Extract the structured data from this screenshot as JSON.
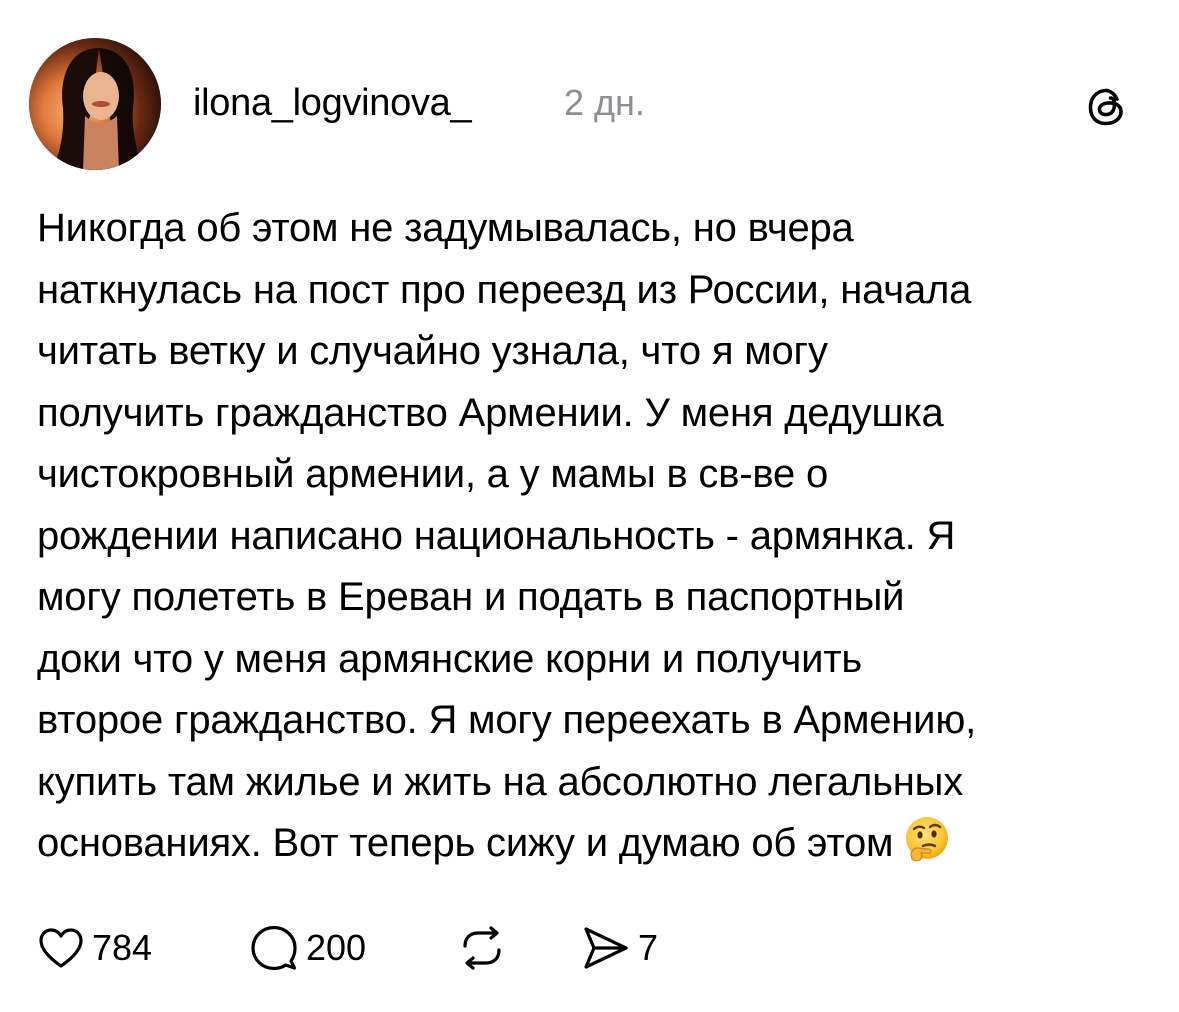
{
  "post": {
    "username": "ilona_logvinova_",
    "time": "2 дн.",
    "text_lines": [
      "Никогда об этом не задумывалась, но вчера",
      "наткнулась на пост про переезд из России, начала",
      "читать ветку и случайно узнала, что я могу",
      "получить гражданство Армении. У меня дедушка",
      "чистокровный армении, а у мамы в св-ве о",
      "рождении написано национальность - армянка. Я",
      "могу полететь в Ереван и подать в паспортный",
      "доки что у меня армянские корни и получить",
      "второе гражданство. Я могу переехать в Армению,",
      "купить там жилье и жить на абсолютно легальных",
      "основаниях. Вот теперь сижу и думаю об этом"
    ]
  },
  "actions": {
    "likes": "784",
    "replies": "200",
    "shares": "7"
  },
  "icons": {
    "like": "heart-icon",
    "reply": "speech-bubble-icon",
    "repost": "repost-icon",
    "share": "send-icon",
    "app": "threads-logo-icon",
    "emoji": "thinking-face-emoji"
  },
  "colors": {
    "text": "#000000",
    "muted": "#8e8e93",
    "background": "#ffffff"
  }
}
